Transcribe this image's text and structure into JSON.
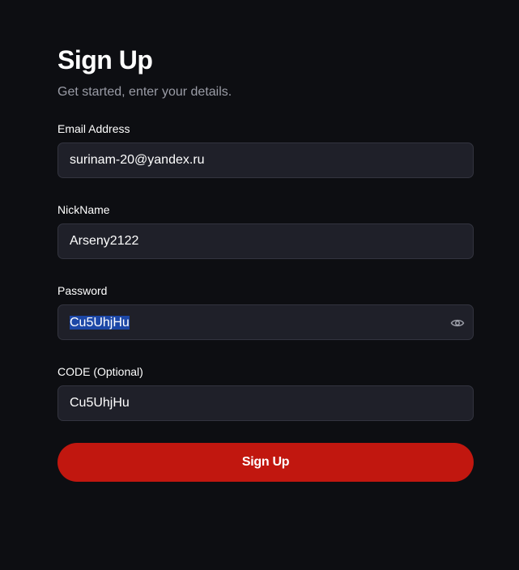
{
  "header": {
    "title": "Sign Up",
    "subtitle": "Get started, enter your details."
  },
  "fields": {
    "email": {
      "label": "Email Address",
      "value": "surinam-20@yandex.ru"
    },
    "nickname": {
      "label": "NickName",
      "value": "Arseny2122"
    },
    "password": {
      "label": "Password",
      "value": "Cu5UhjHu",
      "toggle_icon": "eye-icon"
    },
    "code": {
      "label": "CODE (Optional)",
      "value": "Cu5UhjHu"
    }
  },
  "submit": {
    "label": "Sign Up"
  },
  "colors": {
    "background": "#0d0e12",
    "input_bg": "#1f2029",
    "input_border": "#33343f",
    "accent": "#c1170f",
    "selection": "#1c47a6",
    "subtitle": "#9a9ca6"
  }
}
